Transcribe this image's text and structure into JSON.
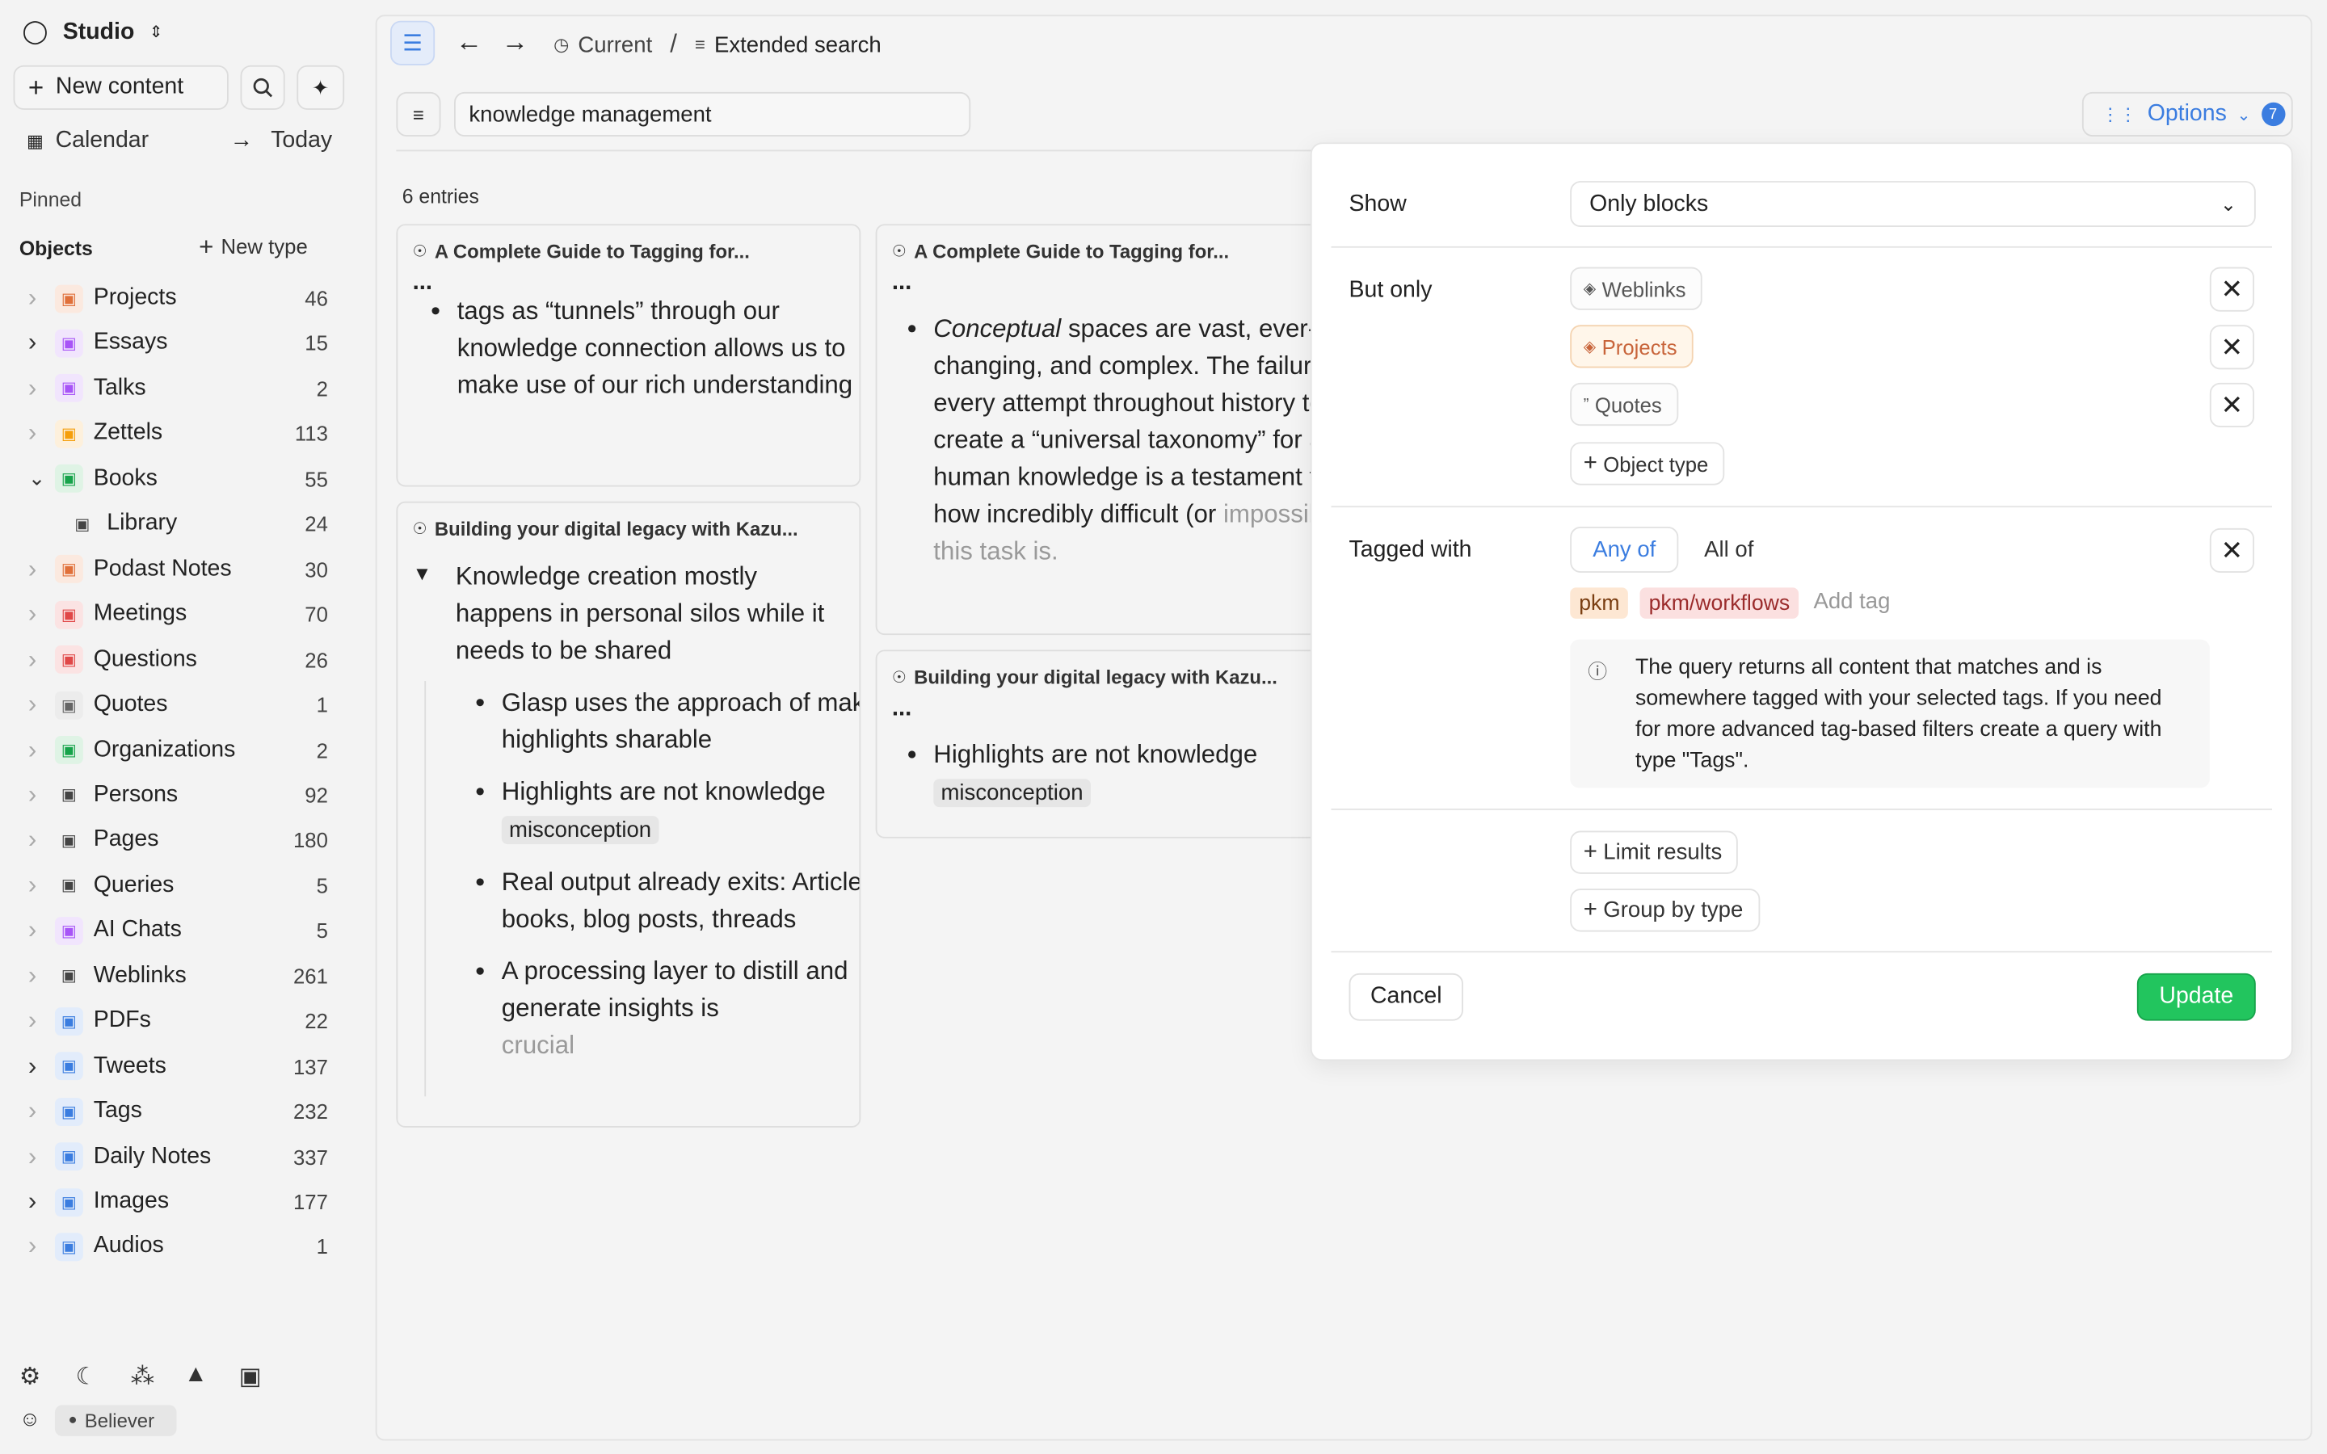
{
  "sidebar": {
    "workspace": "Studio",
    "new_content": "New content",
    "calendar": "Calendar",
    "today": "Today",
    "pinned": "Pinned",
    "objects": "Objects",
    "new_type": "New type",
    "items": [
      {
        "label": "Projects",
        "count": "46",
        "icon": "package-icon",
        "color": "#e0703a",
        "bg": "#fbe9df",
        "expanded": false,
        "children": false
      },
      {
        "label": "Essays",
        "count": "15",
        "icon": "pen-icon",
        "color": "#a855f7",
        "bg": "#f1e5fd",
        "expanded": false,
        "children": true
      },
      {
        "label": "Talks",
        "count": "2",
        "icon": "presentation-icon",
        "color": "#a855f7",
        "bg": "#f1e5fd",
        "expanded": false,
        "children": false
      },
      {
        "label": "Zettels",
        "count": "113",
        "icon": "lightbulb-icon",
        "color": "#f59e0b",
        "bg": "#fdf0dc",
        "expanded": false,
        "children": false
      },
      {
        "label": "Books",
        "count": "55",
        "icon": "books-icon",
        "color": "#16a34a",
        "bg": "#dff3e5",
        "expanded": true,
        "children": true
      },
      {
        "label": "Library",
        "count": "24",
        "icon": "library-icon",
        "color": "#444",
        "bg": "transparent",
        "expanded": false,
        "children": false,
        "indent": true
      },
      {
        "label": "Podast Notes",
        "count": "30",
        "icon": "microphone-icon",
        "color": "#e0703a",
        "bg": "#fbe9df",
        "expanded": false,
        "children": false
      },
      {
        "label": "Meetings",
        "count": "70",
        "icon": "calendar-icon",
        "color": "#e04848",
        "bg": "#fbe3e3",
        "expanded": false,
        "children": false
      },
      {
        "label": "Questions",
        "count": "26",
        "icon": "question-icon",
        "color": "#e04848",
        "bg": "#fbe3e3",
        "expanded": false,
        "children": false
      },
      {
        "label": "Quotes",
        "count": "1",
        "icon": "quote-icon",
        "color": "#666",
        "bg": "#ececec",
        "expanded": false,
        "children": false
      },
      {
        "label": "Organizations",
        "count": "2",
        "icon": "building-icon",
        "color": "#16a34a",
        "bg": "#dff3e5",
        "expanded": false,
        "children": false
      },
      {
        "label": "Persons",
        "count": "92",
        "icon": "person-icon",
        "color": "#444",
        "bg": "transparent",
        "expanded": false,
        "children": false
      },
      {
        "label": "Pages",
        "count": "180",
        "icon": "page-icon",
        "color": "#444",
        "bg": "transparent",
        "expanded": false,
        "children": false
      },
      {
        "label": "Queries",
        "count": "5",
        "icon": "query-icon",
        "color": "#444",
        "bg": "transparent",
        "expanded": false,
        "children": false
      },
      {
        "label": "AI Chats",
        "count": "5",
        "icon": "chat-icon",
        "color": "#a855f7",
        "bg": "#f1e5fd",
        "expanded": false,
        "children": false
      },
      {
        "label": "Weblinks",
        "count": "261",
        "icon": "globe-icon",
        "color": "#444",
        "bg": "transparent",
        "expanded": false,
        "children": false
      },
      {
        "label": "PDFs",
        "count": "22",
        "icon": "pdf-icon",
        "color": "#3b7de0",
        "bg": "#e2ecfb",
        "expanded": false,
        "children": false
      },
      {
        "label": "Tweets",
        "count": "137",
        "icon": "bird-icon",
        "color": "#3b7de0",
        "bg": "#e2ecfb",
        "expanded": false,
        "children": true
      },
      {
        "label": "Tags",
        "count": "232",
        "icon": "tag-icon",
        "color": "#3b7de0",
        "bg": "#e2ecfb",
        "expanded": false,
        "children": false
      },
      {
        "label": "Daily Notes",
        "count": "337",
        "icon": "calendar-check-icon",
        "color": "#3b7de0",
        "bg": "#e2ecfb",
        "expanded": false,
        "children": false
      },
      {
        "label": "Images",
        "count": "177",
        "icon": "image-icon",
        "color": "#3b7de0",
        "bg": "#e2ecfb",
        "expanded": false,
        "children": true
      },
      {
        "label": "Audios",
        "count": "1",
        "icon": "waveform-icon",
        "color": "#3b7de0",
        "bg": "#e2ecfb",
        "expanded": false,
        "children": false
      }
    ],
    "plan_badge": "Believer"
  },
  "header": {
    "crumb_current": "Current",
    "separator": "/",
    "crumb_page": "Extended search"
  },
  "search": {
    "value": "knowledge management",
    "options_label": "Options",
    "options_count": "7"
  },
  "results": {
    "count_label": "6 entries",
    "cards": [
      {
        "title": "A Complete Guide to Tagging for...",
        "dots": "...",
        "bullets": [
          "tags as “tunnels” through our knowledge connection allows us to make use of our rich understanding"
        ]
      },
      {
        "title": "Building your digital legacy with Kazu...",
        "heading": "Knowledge creation mostly happens in personal silos while it needs to be shared",
        "bullets": [
          "Glasp uses the approach of making highlights sharable",
          "Highlights are not knowledge",
          "Real output already exits: Articles, books, blog posts, threads",
          "A processing layer to distill and generate insights is"
        ],
        "code": "misconception",
        "faded": "crucial"
      },
      {
        "title": "A Complete Guide to Tagging for...",
        "dots": "...",
        "em": "Conceptual",
        "bullet_rest": " spaces are vast, ever-changing, and complex. The failure of every attempt throughout history to create a “universal taxonomy” for all human knowledge is a testament to how incredibly difficult (or",
        "faded": "impossible) this task is."
      },
      {
        "title": "Building your digital legacy with Kazu...",
        "dots": "...",
        "bullets": [
          "Highlights are not knowledge"
        ],
        "code": "misconception"
      }
    ]
  },
  "options": {
    "show_label": "Show",
    "show_value": "Only blocks",
    "but_only_label": "But only",
    "types": [
      {
        "label": "Weblinks",
        "icon": "globe-icon",
        "color": "#555",
        "bg": "#fcfcfc",
        "border": "#e2e2e2"
      },
      {
        "label": "Projects",
        "icon": "package-icon",
        "color": "#c8643a",
        "bg": "#fff6ea",
        "border": "#f4d3b0"
      },
      {
        "label": "Quotes",
        "icon": "quote-icon",
        "color": "#555",
        "bg": "#fcfcfc",
        "border": "#e2e2e2"
      }
    ],
    "add_type": "Object type",
    "tagged_label": "Tagged with",
    "any_of": "Any of",
    "all_of": "All of",
    "tags": [
      {
        "label": "pkm",
        "color": "#7a3e12",
        "bg": "#fde7d3"
      },
      {
        "label": "pkm/workflows",
        "color": "#9b2c2c",
        "bg": "#fbe0e0"
      }
    ],
    "add_tag": "Add tag",
    "info": "The query returns all content that matches and is somewhere tagged with your selected tags. If you need for more advanced tag-based filters create a query with type \"Tags\".",
    "limit": "Limit results",
    "group": "Group by type",
    "cancel": "Cancel",
    "update": "Update"
  },
  "colors": {
    "accent": "#3b7de0",
    "update_green": "#22c55e"
  }
}
